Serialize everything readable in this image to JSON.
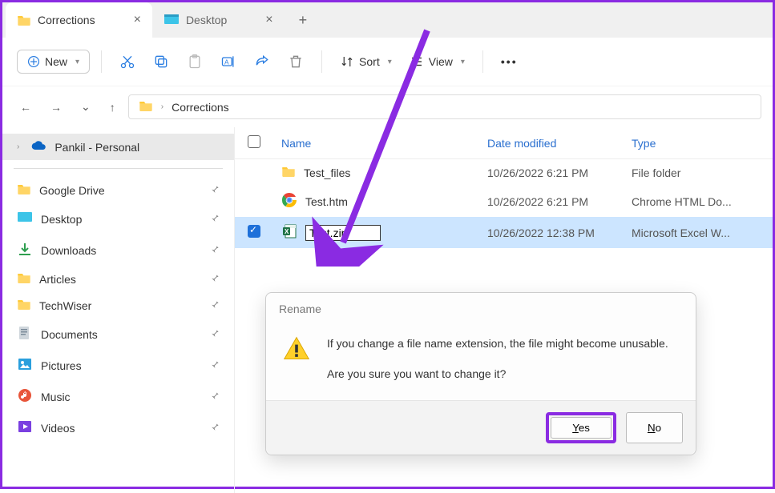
{
  "tabs": {
    "active_label": "Corrections",
    "inactive_label": "Desktop"
  },
  "toolbar": {
    "new_label": "New",
    "sort_label": "Sort",
    "view_label": "View"
  },
  "breadcrumb": {
    "folder": "Corrections"
  },
  "sidebar": {
    "top_item": "Pankil - Personal",
    "items": [
      {
        "label": "Google Drive",
        "icon": "folder"
      },
      {
        "label": "Desktop",
        "icon": "desktop"
      },
      {
        "label": "Downloads",
        "icon": "downloads"
      },
      {
        "label": "Articles",
        "icon": "folder"
      },
      {
        "label": "TechWiser",
        "icon": "folder"
      },
      {
        "label": "Documents",
        "icon": "documents"
      },
      {
        "label": "Pictures",
        "icon": "pictures"
      },
      {
        "label": "Music",
        "icon": "music"
      },
      {
        "label": "Videos",
        "icon": "videos"
      }
    ]
  },
  "columns": {
    "name": "Name",
    "date": "Date modified",
    "type": "Type"
  },
  "rows": [
    {
      "name": "Test_files",
      "date": "10/26/2022 6:21 PM",
      "type": "File folder",
      "icon": "folder",
      "selected": false
    },
    {
      "name": "Test.htm",
      "date": "10/26/2022 6:21 PM",
      "type": "Chrome HTML Do...",
      "icon": "chrome",
      "selected": false
    },
    {
      "name": "Test.zip",
      "date": "10/26/2022 12:38 PM",
      "type": "Microsoft Excel W...",
      "icon": "excel",
      "selected": true,
      "renaming": true
    }
  ],
  "dialog": {
    "title": "Rename",
    "line1": "If you change a file name extension, the file might become unusable.",
    "line2": "Are you sure you want to change it?",
    "yes": "Yes",
    "no": "No"
  }
}
